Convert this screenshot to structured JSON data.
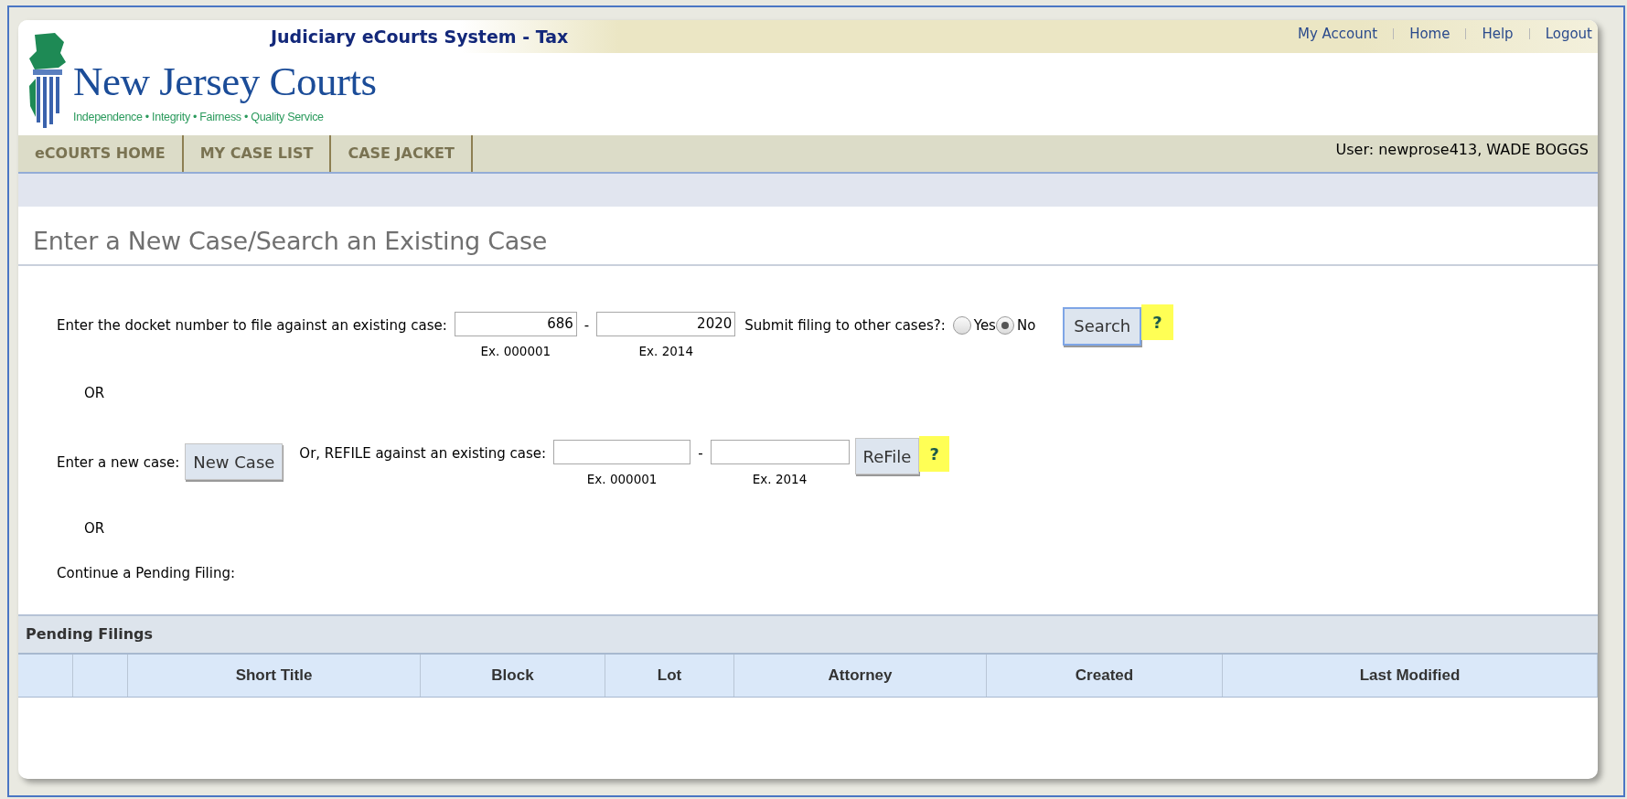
{
  "header": {
    "system_title": "Judiciary eCourts System - Tax",
    "top_links": [
      "My Account",
      "Home",
      "Help",
      "Logout"
    ],
    "logo": {
      "name": "New Jersey Courts",
      "tagline": "Independence • Integrity • Fairness • Quality Service"
    }
  },
  "nav": {
    "tabs": [
      {
        "label": "eCOURTS HOME",
        "selected": false
      },
      {
        "label": "MY CASE LIST",
        "selected": false
      },
      {
        "label": "CASE JACKET",
        "selected": false
      }
    ],
    "user": "User: newprose413, WADE BOGGS"
  },
  "page_title": "Enter a New Case/Search an Existing Case",
  "docket_row": {
    "label": "Enter the docket number to file against an existing case:",
    "number_field": {
      "value": "686",
      "example": "Ex. 000001"
    },
    "dash": "-",
    "year_field": {
      "value": "2020",
      "example": "Ex. 2014"
    },
    "question": "Submit filing to other cases?:",
    "radios": [
      {
        "label": "Yes",
        "selected": false
      },
      {
        "label": "No",
        "selected": true
      }
    ],
    "button": "Search",
    "help": "?"
  },
  "or_1": "OR",
  "new_case_row": {
    "label": "Enter a new case:",
    "new_case_button": "New Case",
    "refile_label": "Or, REFILE against an existing case:",
    "number_field": {
      "example": "Ex. 000001"
    },
    "dash": "-",
    "year_field": {
      "example": "Ex. 2014"
    },
    "button": "ReFile",
    "help": "?"
  },
  "or_2": "OR",
  "continue_label": "Continue a Pending Filing:",
  "pending": {
    "title": "Pending Filings",
    "columns": [
      "",
      "",
      "Short Title",
      "Block",
      "Lot",
      "Attorney",
      "Created",
      "Last Modified"
    ]
  }
}
